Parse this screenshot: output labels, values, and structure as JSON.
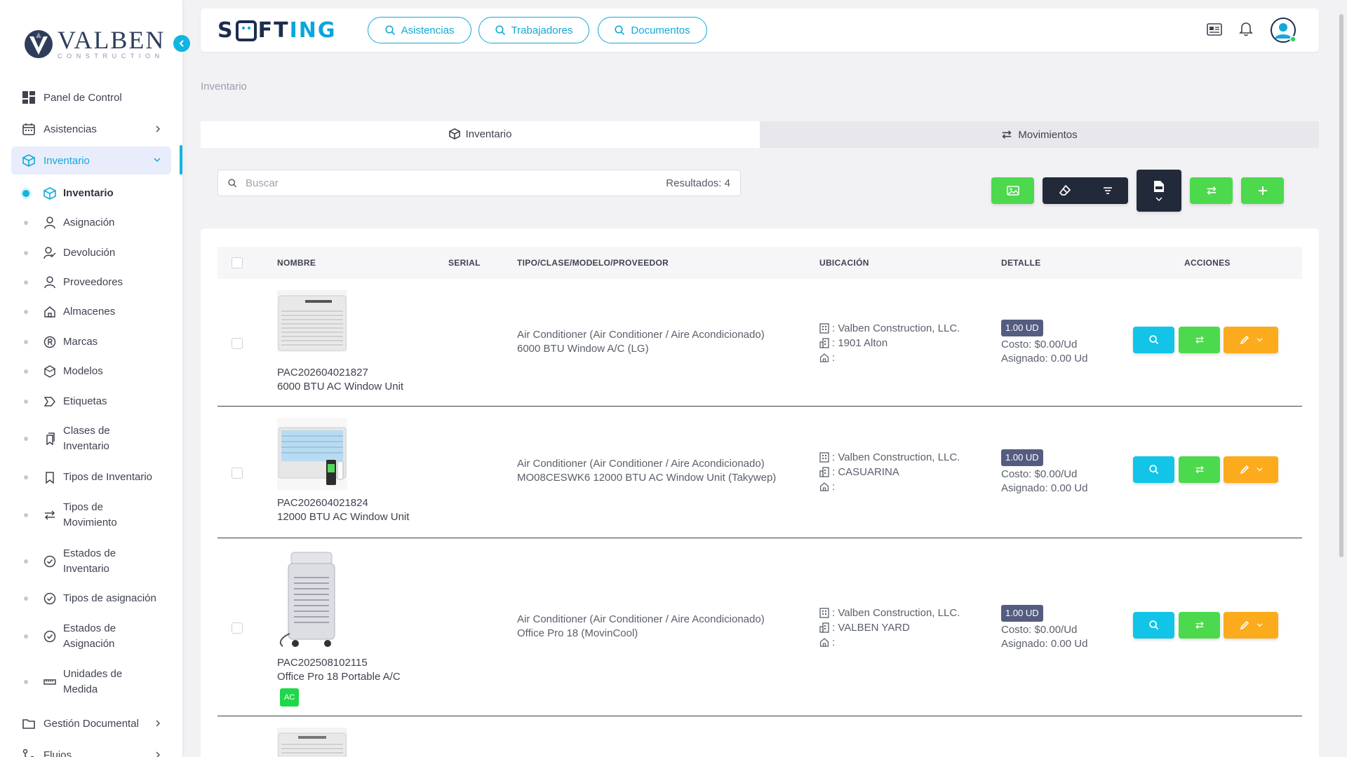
{
  "sidebar": {
    "logo": {
      "name": "VALBEN",
      "sub": "CONSTRUCTION"
    },
    "main_top": [
      {
        "label": "Panel de Control",
        "icon": "dashboard-icon"
      },
      {
        "label": "Asistencias",
        "icon": "calendar-icon"
      },
      {
        "label": "Inventario",
        "icon": "box-icon",
        "active": true
      }
    ],
    "sub_items": [
      {
        "label": "Inventario",
        "icon": "box-icon",
        "current": true
      },
      {
        "label": "Asignación",
        "icon": "user-icon"
      },
      {
        "label": "Devolución",
        "icon": "user-check-icon"
      },
      {
        "label": "Proveedores",
        "icon": "user-icon"
      },
      {
        "label": "Almacenes",
        "icon": "home-icon"
      },
      {
        "label": "Marcas",
        "icon": "registered-icon"
      },
      {
        "label": "Modelos",
        "icon": "hexagon-icon"
      },
      {
        "label": "Etiquetas",
        "icon": "tag-icon"
      },
      {
        "label": "Clases de Inventario",
        "icon": "bookmarks-icon"
      },
      {
        "label": "Tipos de Inventario",
        "icon": "bookmark-icon"
      },
      {
        "label": "Tipos de Movimiento",
        "icon": "arrows-icon"
      },
      {
        "label": "Estados de Inventario",
        "icon": "check-circle-icon"
      },
      {
        "label": "Tipos de asignación",
        "icon": "check-circle-icon"
      },
      {
        "label": "Estados de Asignación",
        "icon": "check-circle-icon"
      },
      {
        "label": "Unidades de Medida",
        "icon": "ruler-icon"
      }
    ],
    "main_bottom": [
      {
        "label": "Gestión Documental",
        "icon": "folder-icon"
      },
      {
        "label": "Flujos",
        "icon": "flow-icon"
      }
    ]
  },
  "topbar": {
    "brand_s": "S",
    "brand_ft": "FT",
    "brand_ing": "ING",
    "quick_links": [
      "Asistencias",
      "Trabajadores",
      "Documentos"
    ]
  },
  "breadcrumb": "Inventario",
  "tabs": [
    "Inventario",
    "Movimientos"
  ],
  "search": {
    "placeholder": "Buscar",
    "results_label": "Resultados: 4"
  },
  "table": {
    "headers": [
      "NOMBRE",
      "SERIAL",
      "TIPO/CLASE/MODELO/PROVEEDOR",
      "UBICACIÓN",
      "DETALLE",
      "ACCIONES"
    ],
    "rows": [
      {
        "code": "PAC202604021827",
        "name": "6000 BTU AC Window Unit",
        "type_line1": "Air Conditioner (Air Conditioner / Aire Acondicionado)",
        "type_line2": "6000 BTU Window A/C (LG)",
        "company": ": Valben Construction, LLC.",
        "site": ": 1901 Alton",
        "warehouse": ":",
        "qty": "1.00 UD",
        "cost": "Costo: $0.00/Ud",
        "assigned": "Asignado: 0.00 Ud"
      },
      {
        "code": "PAC202604021824",
        "name": "12000 BTU AC Window Unit",
        "type_line1": "Air Conditioner (Air Conditioner / Aire Acondicionado)",
        "type_line2": "MO08CESWK6 12000 BTU AC Window Unit (Takywep)",
        "company": ": Valben Construction, LLC.",
        "site": ": CASUARINA",
        "warehouse": ":",
        "qty": "1.00 UD",
        "cost": "Costo: $0.00/Ud",
        "assigned": "Asignado: 0.00 Ud"
      },
      {
        "code": "PAC202508102115",
        "name": "Office Pro 18 Portable A/C",
        "tag": "AC",
        "type_line1": "Air Conditioner (Air Conditioner / Aire Acondicionado)",
        "type_line2": "Office Pro 18 (MovinCool)",
        "company": ": Valben Construction, LLC.",
        "site": ": VALBEN YARD",
        "warehouse": ":",
        "qty": "1.00 UD",
        "cost": "Costo: $0.00/Ud",
        "assigned": "Asignado: 0.00 Ud"
      }
    ]
  },
  "colors": {
    "accent": "#12b3e0",
    "green": "#4dd94d",
    "dark": "#222a3a",
    "orange": "#fbab1c",
    "cyan": "#12c4e8",
    "badge": "#545d80"
  }
}
